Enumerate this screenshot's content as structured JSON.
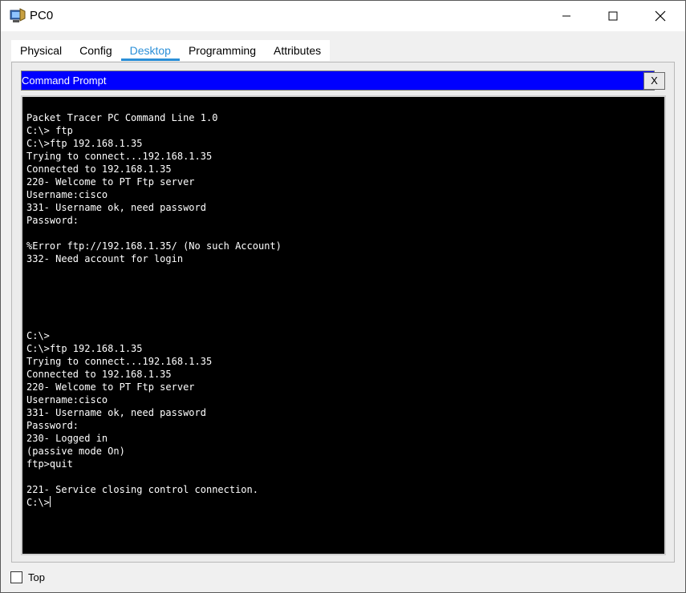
{
  "window": {
    "title": "PC0",
    "icon": "pc-app-icon",
    "controls": [
      "minimize-icon",
      "maximize-icon",
      "close-icon"
    ]
  },
  "tabs": [
    {
      "label": "Physical",
      "active": false
    },
    {
      "label": "Config",
      "active": false
    },
    {
      "label": "Desktop",
      "active": true
    },
    {
      "label": "Programming",
      "active": false
    },
    {
      "label": "Attributes",
      "active": false
    }
  ],
  "command_prompt": {
    "title": "Command Prompt",
    "close_label": "X",
    "header_color": "#0000ff",
    "lines": [
      "Packet Tracer PC Command Line 1.0",
      "C:\\> ftp",
      "C:\\>ftp 192.168.1.35",
      "Trying to connect...192.168.1.35",
      "Connected to 192.168.1.35",
      "220- Welcome to PT Ftp server",
      "Username:cisco",
      "331- Username ok, need password",
      "Password:",
      "",
      "%Error ftp://192.168.1.35/ (No such Account)",
      "332- Need account for login",
      "",
      "",
      "",
      "",
      "",
      "C:\\>",
      "C:\\>ftp 192.168.1.35",
      "Trying to connect...192.168.1.35",
      "Connected to 192.168.1.35",
      "220- Welcome to PT Ftp server",
      "Username:cisco",
      "331- Username ok, need password",
      "Password:",
      "230- Logged in",
      "(passive mode On)",
      "ftp>quit",
      "",
      "221- Service closing control connection."
    ],
    "prompt": "C:\\>"
  },
  "bottom": {
    "top_checkbox_label": "Top",
    "top_checked": false
  },
  "colors": {
    "accent": "#2a8fd8",
    "terminal_bg": "#000000",
    "terminal_fg": "#ffffff"
  }
}
